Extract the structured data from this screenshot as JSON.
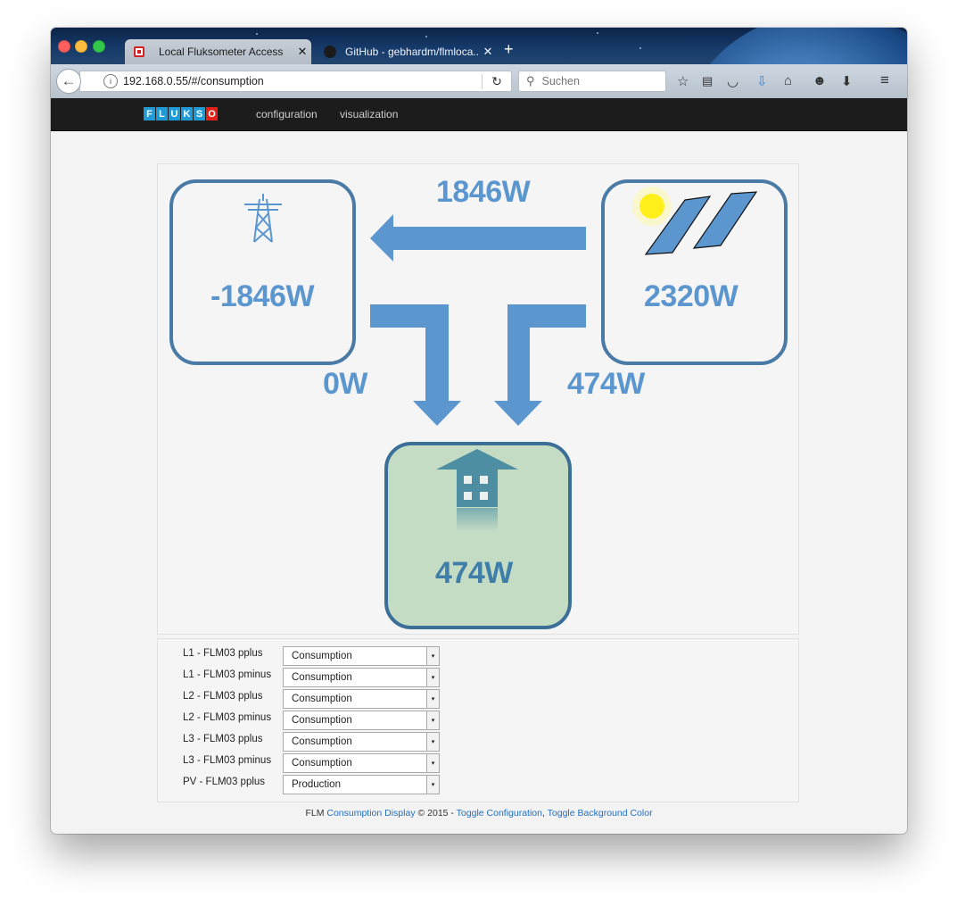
{
  "browser": {
    "tabs": [
      {
        "label": "Local Fluksometer Access",
        "active": true
      },
      {
        "label": "GitHub - gebhardm/flmloca...",
        "active": false
      }
    ],
    "url": "192.168.0.55/#/consumption",
    "search_placeholder": "Suchen"
  },
  "app": {
    "logo_letters": [
      "F",
      "L",
      "U",
      "K",
      "S",
      "O"
    ],
    "nav": [
      "configuration",
      "visualization"
    ]
  },
  "flow": {
    "grid_value": "-1846W",
    "pv_value": "2320W",
    "house_value": "474W",
    "pv_to_grid": "1846W",
    "grid_to_house": "0W",
    "pv_to_house": "474W"
  },
  "config": {
    "rows": [
      {
        "label": "L1 - FLM03 pplus",
        "value": "Consumption"
      },
      {
        "label": "L1 - FLM03 pminus",
        "value": "Consumption"
      },
      {
        "label": "L2 - FLM03 pplus",
        "value": "Consumption"
      },
      {
        "label": "L2 - FLM03 pminus",
        "value": "Consumption"
      },
      {
        "label": "L3 - FLM03 pplus",
        "value": "Consumption"
      },
      {
        "label": "L3 - FLM03 pminus",
        "value": "Consumption"
      },
      {
        "label": "PV - FLM03 pplus",
        "value": "Production"
      }
    ]
  },
  "footer": {
    "prefix": "FLM",
    "link1": "Consumption Display",
    "middle": "© 2015 -",
    "link2": "Toggle Configuration",
    "sep": ",",
    "link3": "Toggle Background Color"
  },
  "colors": {
    "accent": "#5b96cf",
    "node_border": "#4a7aa6",
    "house_fill": "#c4dcc4",
    "navbar": "#1c1c1c"
  }
}
